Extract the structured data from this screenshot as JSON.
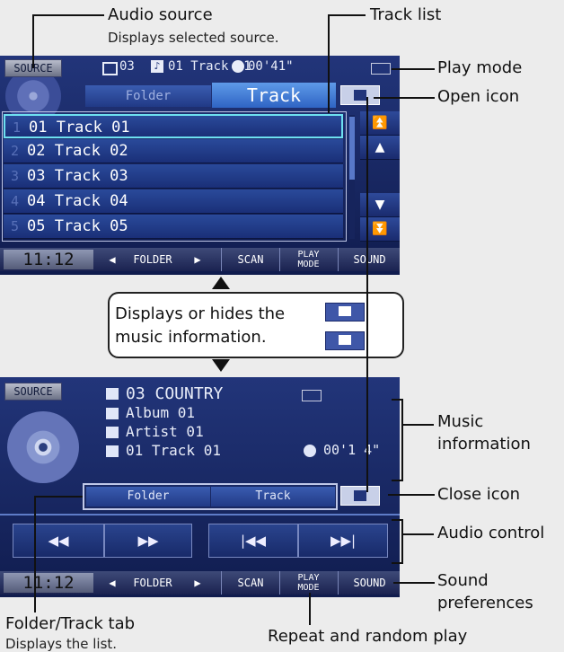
{
  "callouts": {
    "audio_source": "Audio source",
    "audio_source_sub": "Displays selected source.",
    "track_list": "Track list",
    "play_mode": "Play mode",
    "open_icon": "Open icon",
    "music_information_1": "Music",
    "music_information_2": "information",
    "close_icon": "Close icon",
    "audio_control": "Audio control",
    "sound_pref_1": "Sound",
    "sound_pref_2": "preferences",
    "folder_track_tab": "Folder/Track tab",
    "folder_track_tab_sub": "Displays the list.",
    "repeat_random": "Repeat and random play",
    "display_hide_1": "Displays or hides the",
    "display_hide_2": "music information."
  },
  "top_screen": {
    "source_button": "SOURCE",
    "folder_num": "03",
    "track_info": "01 Track 01",
    "time": "00'41\"",
    "tab_folder": "Folder",
    "tab_track": "Track",
    "tracks": [
      {
        "num": "1",
        "label": "01 Track 01"
      },
      {
        "num": "2",
        "label": "02 Track 02"
      },
      {
        "num": "3",
        "label": "03 Track 03"
      },
      {
        "num": "4",
        "label": "04 Track 04"
      },
      {
        "num": "5",
        "label": "05 Track 05"
      }
    ],
    "clock": "11:12",
    "folder_label": "FOLDER",
    "scan": "SCAN",
    "play": "PLAY",
    "mode": "MODE",
    "sound": "SOUND"
  },
  "bottom_screen": {
    "source_button": "SOURCE",
    "folder": "03  COUNTRY",
    "album": "Album 01",
    "artist": "Artist 01",
    "track": "01 Track 01",
    "time": "00'1 4\"",
    "tab_folder": "Folder",
    "tab_track": "Track",
    "clock": "11:12",
    "folder_label": "FOLDER",
    "scan": "SCAN",
    "play": "PLAY",
    "mode": "MODE",
    "sound": "SOUND"
  }
}
